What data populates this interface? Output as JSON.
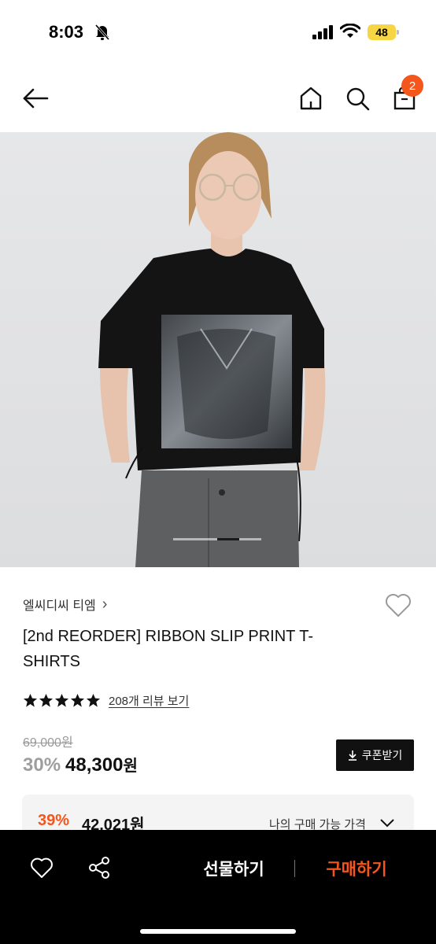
{
  "status": {
    "time": "8:03",
    "battery": "48"
  },
  "header": {
    "cart_count": "2"
  },
  "product": {
    "brand": "엘씨디씨 티엠",
    "brand_chevron": "›",
    "title": "[2nd REORDER] RIBBON SLIP PRINT T-SHIRTS",
    "rating_stars": 5,
    "review_link": "208개 리뷰 보기",
    "original_price": "69,000원",
    "discount_rate": "30%",
    "sale_price": "48,300",
    "sale_unit": "원",
    "coupon_label": "쿠폰받기"
  },
  "my_price": {
    "rate": "39%",
    "price": "42,021원",
    "label": "나의 구매 가능 가격"
  },
  "bottom_bar": {
    "gift_label": "선물하기",
    "buy_label": "구매하기"
  },
  "colors": {
    "accent": "#f4561b",
    "badge_bg": "#f4561b",
    "bottom_bg": "#000000",
    "battery": "#f6d645"
  },
  "icons": [
    "back-arrow-icon",
    "home-icon",
    "search-icon",
    "shopping-bag-icon",
    "heart-icon",
    "share-icon",
    "download-icon",
    "chevron-down-icon",
    "bell-off-icon"
  ]
}
